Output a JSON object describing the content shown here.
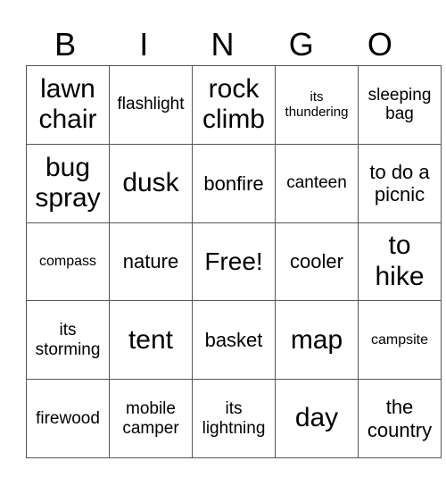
{
  "header": [
    "B",
    "I",
    "N",
    "G",
    "O"
  ],
  "rows": [
    [
      {
        "text": "lawn chair",
        "size": "xl"
      },
      {
        "text": "flashlight",
        "size": "s"
      },
      {
        "text": "rock climb",
        "size": "xl"
      },
      {
        "text": "its thundering",
        "size": "xxs"
      },
      {
        "text": "sleeping bag",
        "size": "s"
      }
    ],
    [
      {
        "text": "bug spray",
        "size": "xl"
      },
      {
        "text": "dusk",
        "size": "xl"
      },
      {
        "text": "bonfire",
        "size": "m"
      },
      {
        "text": "canteen",
        "size": "s"
      },
      {
        "text": "to do a picnic",
        "size": "m"
      }
    ],
    [
      {
        "text": "compass",
        "size": "xs"
      },
      {
        "text": "nature",
        "size": "m"
      },
      {
        "text": "Free!",
        "size": "l"
      },
      {
        "text": "cooler",
        "size": "m"
      },
      {
        "text": "to hike",
        "size": "xl"
      }
    ],
    [
      {
        "text": "its storming",
        "size": "s"
      },
      {
        "text": "tent",
        "size": "xl"
      },
      {
        "text": "basket",
        "size": "m"
      },
      {
        "text": "map",
        "size": "xl"
      },
      {
        "text": "campsite",
        "size": "xs"
      }
    ],
    [
      {
        "text": "firewood",
        "size": "s"
      },
      {
        "text": "mobile camper",
        "size": "s"
      },
      {
        "text": "its lightning",
        "size": "s"
      },
      {
        "text": "day",
        "size": "xl"
      },
      {
        "text": "the country",
        "size": "m"
      }
    ]
  ]
}
